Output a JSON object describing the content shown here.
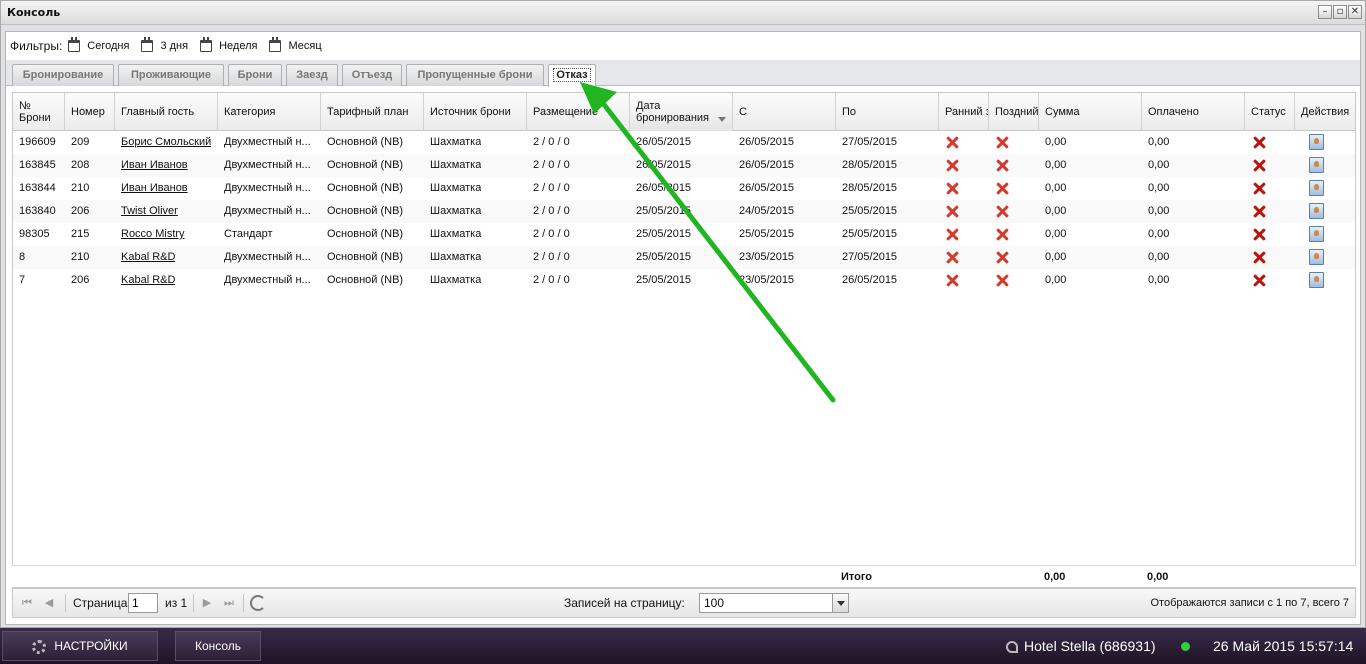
{
  "window": {
    "title": "Консоль",
    "buttons": [
      "–",
      "▫",
      "✕"
    ]
  },
  "filters": {
    "label": "Фильтры:",
    "items": [
      "Сегодня",
      "3 дня",
      "Неделя",
      "Месяц"
    ]
  },
  "tabs": [
    {
      "label": "Бронирование"
    },
    {
      "label": "Проживающие"
    },
    {
      "label": "Брони"
    },
    {
      "label": "Заезд"
    },
    {
      "label": "Отъезд"
    },
    {
      "label": "Пропущенные брони"
    },
    {
      "label": "Отказ",
      "active": true
    }
  ],
  "table": {
    "headers": {
      "id": "№ Брони",
      "room": "Номер",
      "guest": "Главный гость",
      "category": "Категория",
      "rate": "Тарифный план",
      "source": "Источник брони",
      "placement": "Размещение",
      "booking_date": "Дата бронирования",
      "from": "С",
      "to": "По",
      "early": "Ранний з",
      "late": "Поздний",
      "sum": "Сумма",
      "paid": "Оплачено",
      "status": "Статус",
      "actions": "Действия"
    },
    "rows": [
      {
        "id": "196609",
        "room": "209",
        "guest": "Борис Смольский",
        "category": "Двухместный н...",
        "rate": "Основной (NB)",
        "source": "Шахматка",
        "placement": "2 / 0 / 0",
        "booking_date": "26/05/2015",
        "from": "26/05/2015",
        "to": "27/05/2015",
        "sum": "0,00",
        "paid": "0,00"
      },
      {
        "id": "163845",
        "room": "208",
        "guest": "Иван Иванов",
        "category": "Двухместный н...",
        "rate": "Основной (NB)",
        "source": "Шахматка",
        "placement": "2 / 0 / 0",
        "booking_date": "26/05/2015",
        "from": "26/05/2015",
        "to": "28/05/2015",
        "sum": "0,00",
        "paid": "0,00"
      },
      {
        "id": "163844",
        "room": "210",
        "guest": "Иван Иванов",
        "category": "Двухместный н...",
        "rate": "Основной (NB)",
        "source": "Шахматка",
        "placement": "2 / 0 / 0",
        "booking_date": "26/05/2015",
        "from": "26/05/2015",
        "to": "28/05/2015",
        "sum": "0,00",
        "paid": "0,00"
      },
      {
        "id": "163840",
        "room": "206",
        "guest": "Twist Oliver",
        "category": "Двухместный н...",
        "rate": "Основной (NB)",
        "source": "Шахматка",
        "placement": "2 / 0 / 0",
        "booking_date": "25/05/2015",
        "from": "24/05/2015",
        "to": "25/05/2015",
        "sum": "0,00",
        "paid": "0,00"
      },
      {
        "id": "98305",
        "room": "215",
        "guest": "Rocco Mistry",
        "category": "Стандарт",
        "rate": "Основной (NB)",
        "source": "Шахматка",
        "placement": "2 / 0 / 0",
        "booking_date": "25/05/2015",
        "from": "25/05/2015",
        "to": "25/05/2015",
        "sum": "0,00",
        "paid": "0,00"
      },
      {
        "id": "8",
        "room": "210",
        "guest": "Kabal R&D",
        "category": "Двухместный н...",
        "rate": "Основной (NB)",
        "source": "Шахматка",
        "placement": "2 / 0 / 0",
        "booking_date": "25/05/2015",
        "from": "23/05/2015",
        "to": "27/05/2015",
        "sum": "0,00",
        "paid": "0,00"
      },
      {
        "id": "7",
        "room": "206",
        "guest": "Kabal R&D",
        "category": "Двухместный н...",
        "rate": "Основной (NB)",
        "source": "Шахматка",
        "placement": "2 / 0 / 0",
        "booking_date": "25/05/2015",
        "from": "23/05/2015",
        "to": "26/05/2015",
        "sum": "0,00",
        "paid": "0,00"
      }
    ],
    "totals": {
      "label": "Итого",
      "sum": "0,00",
      "paid": "0,00"
    }
  },
  "pager": {
    "page_label": "Страница",
    "page_value": "1",
    "of_label": "из 1",
    "per_page_label": "Записей на страницу:",
    "per_page_value": "100",
    "summary": "Отображаются записи с 1 по 7, всего 7"
  },
  "taskbar": {
    "settings_label": "НАСТРОЙКИ",
    "console_label": "Консоль",
    "hotel": "Hotel Stella (686931)",
    "datetime": "26 Май 2015 15:57:14"
  },
  "colors": {
    "annotation_arrow": "#22b522",
    "status_ok": "#2fd13a",
    "cancel_x": "#d33a2c"
  }
}
